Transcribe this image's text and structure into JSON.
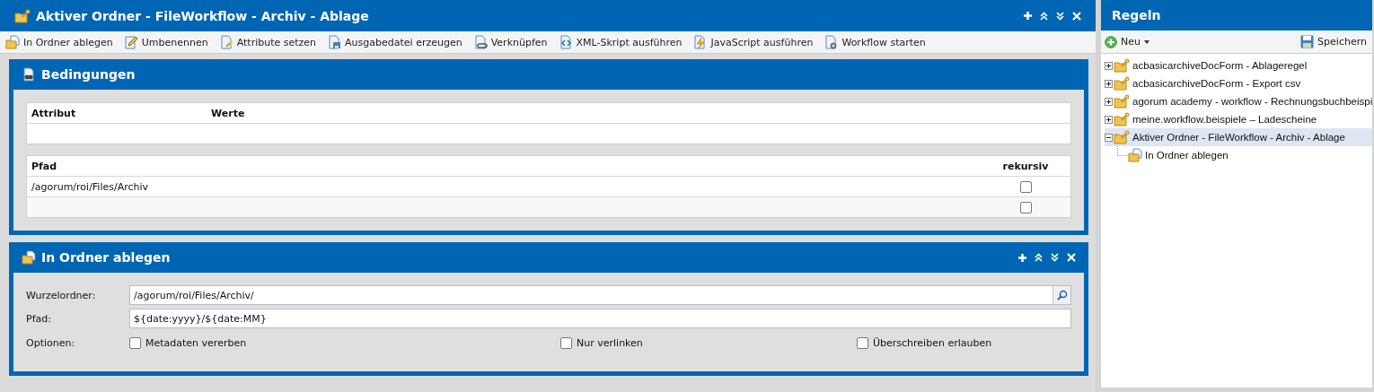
{
  "window": {
    "title": "Aktiver Ordner - FileWorkflow - Archiv - Ablage"
  },
  "toolbar": [
    "In Ordner ablegen",
    "Umbenennen",
    "Attribute setzen",
    "Ausgabedatei erzeugen",
    "Verknüpfen",
    "XML-Skript ausführen",
    "JavaScript ausführen",
    "Workflow starten"
  ],
  "conditions_panel": {
    "title": "Bedingungen",
    "attribute_table": {
      "columns": [
        "Attribut",
        "Werte"
      ]
    },
    "path_table": {
      "columns": [
        "Pfad",
        "rekursiv"
      ],
      "rows": [
        {
          "path": "/agorum/roi/Files/Archiv",
          "rekursiv": false
        },
        {
          "rekursiv": false
        }
      ]
    }
  },
  "action_panel": {
    "title": "In Ordner ablegen",
    "fields": [
      {
        "kind": "search",
        "label": "Wurzelordner:",
        "value": "/agorum/roi/Files/Archiv/"
      },
      {
        "kind": "text",
        "label": "Pfad:",
        "value": "${date:yyyy}/${date:MM}"
      }
    ],
    "options_label": "Optionen:",
    "options": [
      {
        "label": "Metadaten vererben",
        "checked": false
      },
      {
        "label": "Nur verlinken",
        "checked": false
      },
      {
        "label": "Überschreiben erlauben",
        "checked": false
      }
    ]
  },
  "rules_panel": {
    "title": "Regeln",
    "new_button": "Neu",
    "save_button": "Speichern",
    "tree": [
      {
        "label": "acbasicarchiveDocForm - Ablageregel",
        "expanded": false,
        "selected": false
      },
      {
        "label": "acbasicarchiveDocForm - Export csv",
        "expanded": false,
        "selected": false
      },
      {
        "label": "agorum academy - workflow - Rechnungsbuchbeispi",
        "expanded": false,
        "selected": false
      },
      {
        "label": "meine.workflow.beispiele – Ladescheine",
        "expanded": false,
        "selected": false
      },
      {
        "label": "Aktiver Ordner - FileWorkflow - Archiv - Ablage",
        "expanded": true,
        "selected": true,
        "children": [
          {
            "label": "In Ordner ablegen",
            "selected": false
          }
        ]
      }
    ]
  }
}
